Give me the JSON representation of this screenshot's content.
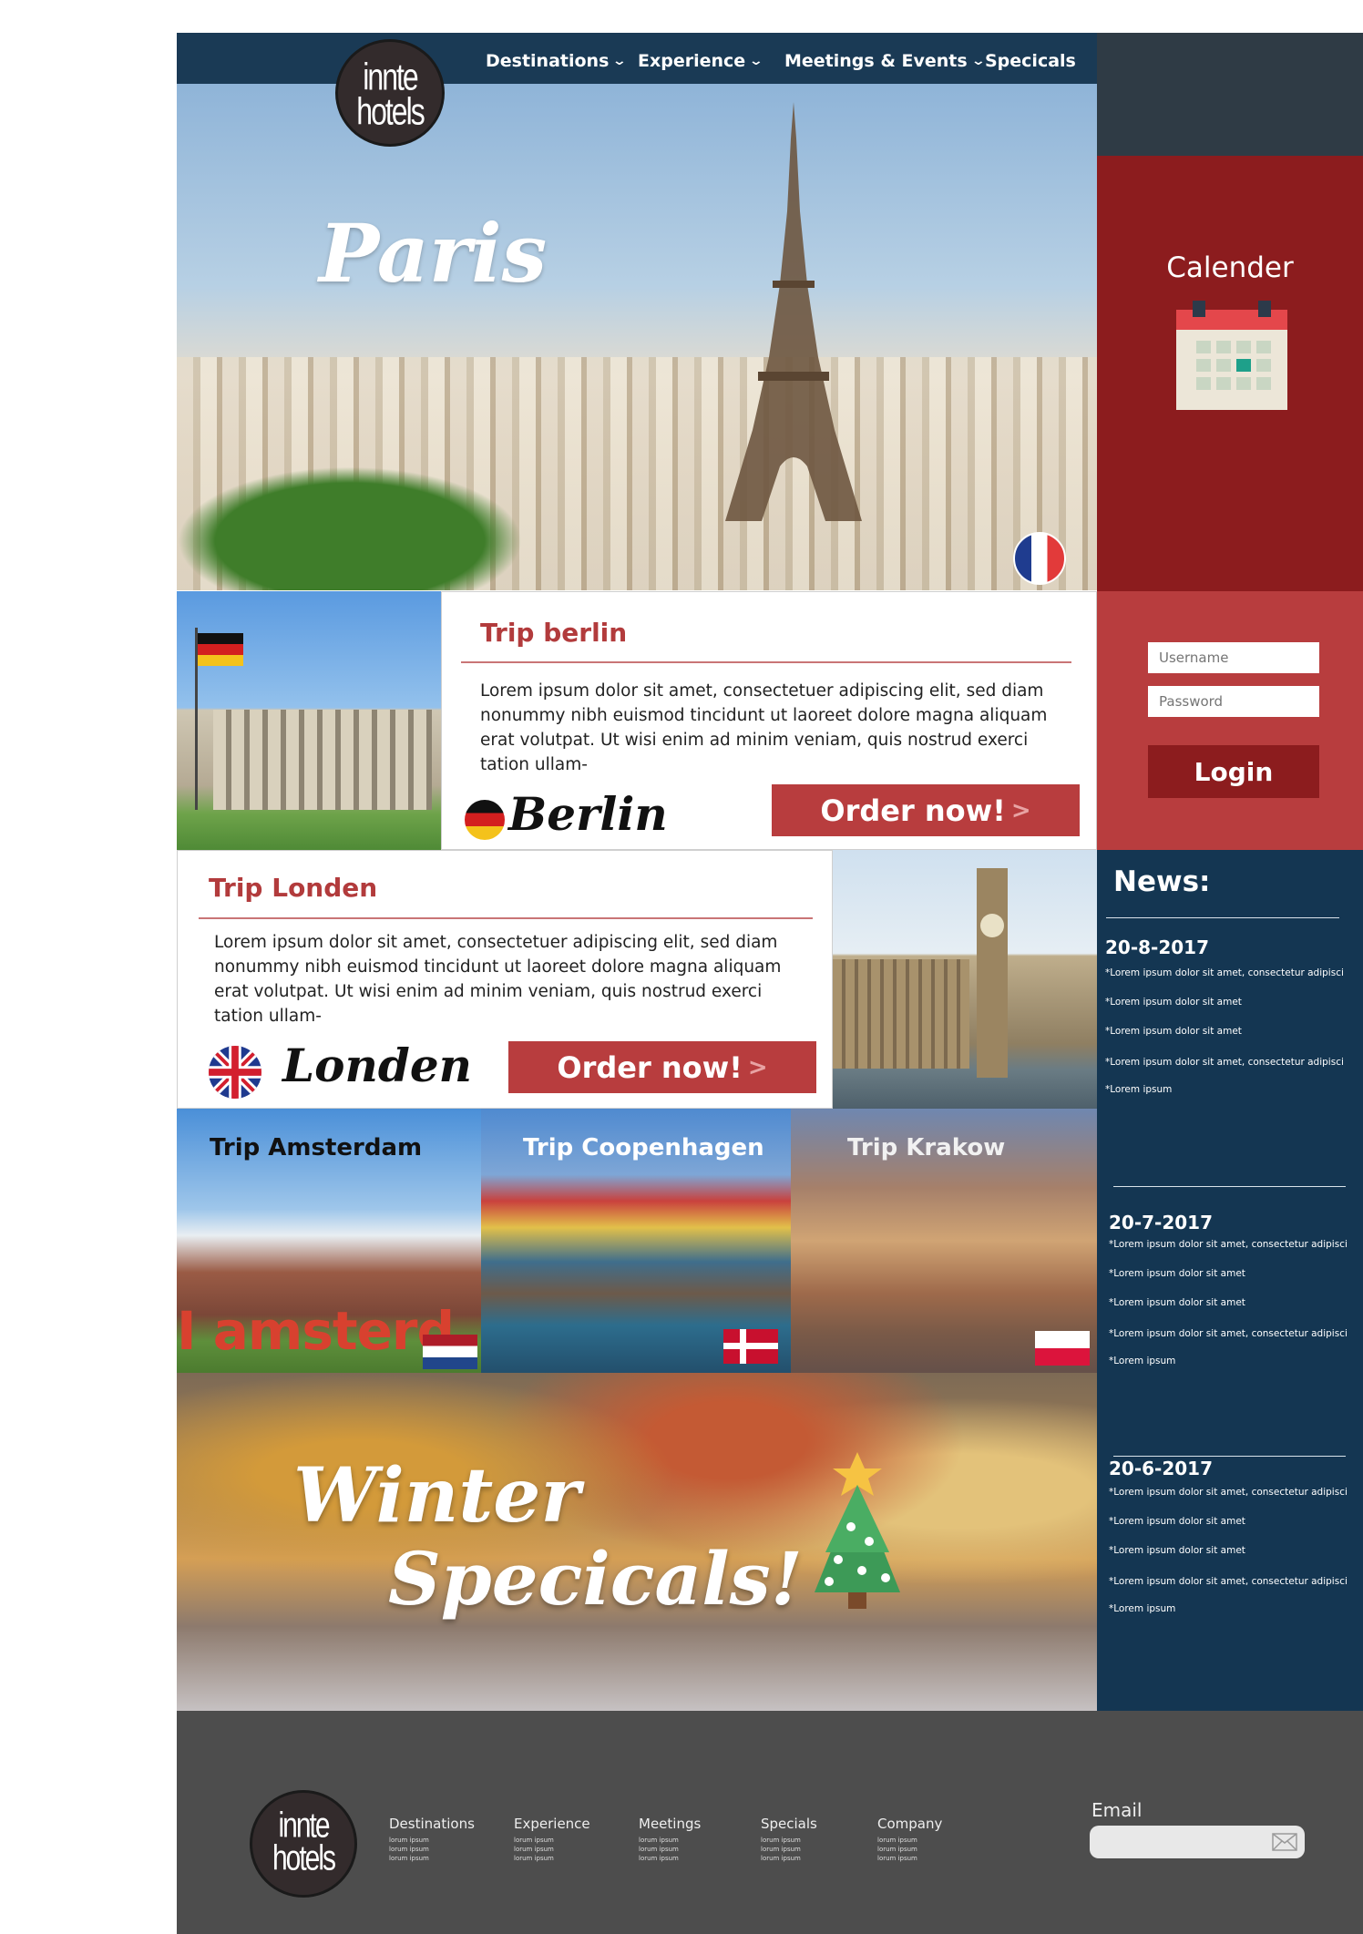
{
  "brand": {
    "logo_line1": "innte",
    "logo_line2": "hotels"
  },
  "nav": {
    "items": [
      {
        "label": "Destinations",
        "has_dropdown": true
      },
      {
        "label": "Experience",
        "has_dropdown": true
      },
      {
        "label": "Meetings & Events",
        "has_dropdown": true
      },
      {
        "label": "Specicals",
        "has_dropdown": false
      }
    ]
  },
  "hero": {
    "title": "Paris"
  },
  "sidebar": {
    "calendar_label": "Calender",
    "username_placeholder": "Username",
    "password_placeholder": "Password",
    "login_label": "Login",
    "news_title": "News:",
    "news": [
      {
        "date": "20-8-2017",
        "lines": [
          "*Lorem ipsum dolor sit amet, consectetur adipisci",
          "*Lorem ipsum dolor sit amet",
          "*Lorem ipsum dolor sit amet",
          "*Lorem ipsum dolor sit amet, consectetur adipisci",
          "*Lorem ipsum"
        ]
      },
      {
        "date": "20-7-2017",
        "lines": [
          "*Lorem ipsum dolor sit amet, consectetur adipisci",
          "*Lorem ipsum dolor sit amet",
          "*Lorem ipsum dolor sit amet",
          "*Lorem ipsum dolor sit amet, consectetur adipisci",
          "*Lorem ipsum"
        ]
      },
      {
        "date": "20-6-2017",
        "lines": [
          "*Lorem ipsum dolor sit amet, consectetur adipisci",
          "*Lorem ipsum dolor sit amet",
          "*Lorem ipsum dolor sit amet",
          "*Lorem ipsum dolor sit amet, consectetur adipisci",
          "*Lorem ipsum"
        ]
      }
    ]
  },
  "trips": {
    "berlin": {
      "title": "Trip berlin",
      "text": "Lorem ipsum dolor sit amet, consectetuer adipiscing elit, sed diam nonummy nibh euismod tincidunt ut laoreet dolore magna aliquam erat volutpat. Ut wisi enim ad minim veniam, quis nostrud exerci tation ullam-",
      "city": "Berlin",
      "order_label": "Order now!",
      "order_arrow": ">"
    },
    "londen": {
      "title": "Trip Londen",
      "text": "Lorem ipsum dolor sit amet, consectetuer adipiscing elit, sed diam nonummy nibh euismod tincidunt ut laoreet dolore magna aliquam erat volutpat. Ut wisi enim ad minim veniam, quis nostrud exerci tation ullam-",
      "city": "Londen",
      "order_label": "Order now!",
      "order_arrow": ">"
    }
  },
  "tiles": [
    {
      "title": "Trip Amsterdam",
      "sign_text": "I amsterd"
    },
    {
      "title": "Trip Coopenhagen"
    },
    {
      "title": "Trip Krakow"
    }
  ],
  "winter": {
    "line1": "Winter",
    "line2": "Specicals!"
  },
  "footer": {
    "columns": [
      {
        "title": "Destinations",
        "subs": [
          "lorum ipsum",
          "lorum ipsum",
          "lorum ipsum"
        ]
      },
      {
        "title": "Experience",
        "subs": [
          "lorum ipsum",
          "lorum ipsum",
          "lorum ipsum"
        ]
      },
      {
        "title": "Meetings",
        "subs": [
          "lorum ipsum",
          "lorum ipsum",
          "lorum ipsum"
        ]
      },
      {
        "title": "Specials",
        "subs": [
          "lorum ipsum",
          "lorum ipsum",
          "lorum ipsum"
        ]
      },
      {
        "title": "Company",
        "subs": [
          "lorum ipsum",
          "lorum ipsum",
          "lorum ipsum"
        ]
      }
    ],
    "email_label": "Email"
  },
  "colors": {
    "nav_bg": "#1a3a55",
    "calendar_bg": "#8c1c1e",
    "login_bg": "#b83d3e",
    "news_bg": "#143652",
    "accent_red": "#b83d3e",
    "footer_bg": "#4d4d4d"
  },
  "icons": [
    "chevron-down-icon",
    "calendar-icon",
    "christmas-tree-icon",
    "mail-icon",
    "france-flag-icon",
    "germany-flag-icon",
    "uk-flag-icon",
    "netherlands-flag-icon",
    "denmark-flag-icon",
    "poland-flag-icon"
  ]
}
